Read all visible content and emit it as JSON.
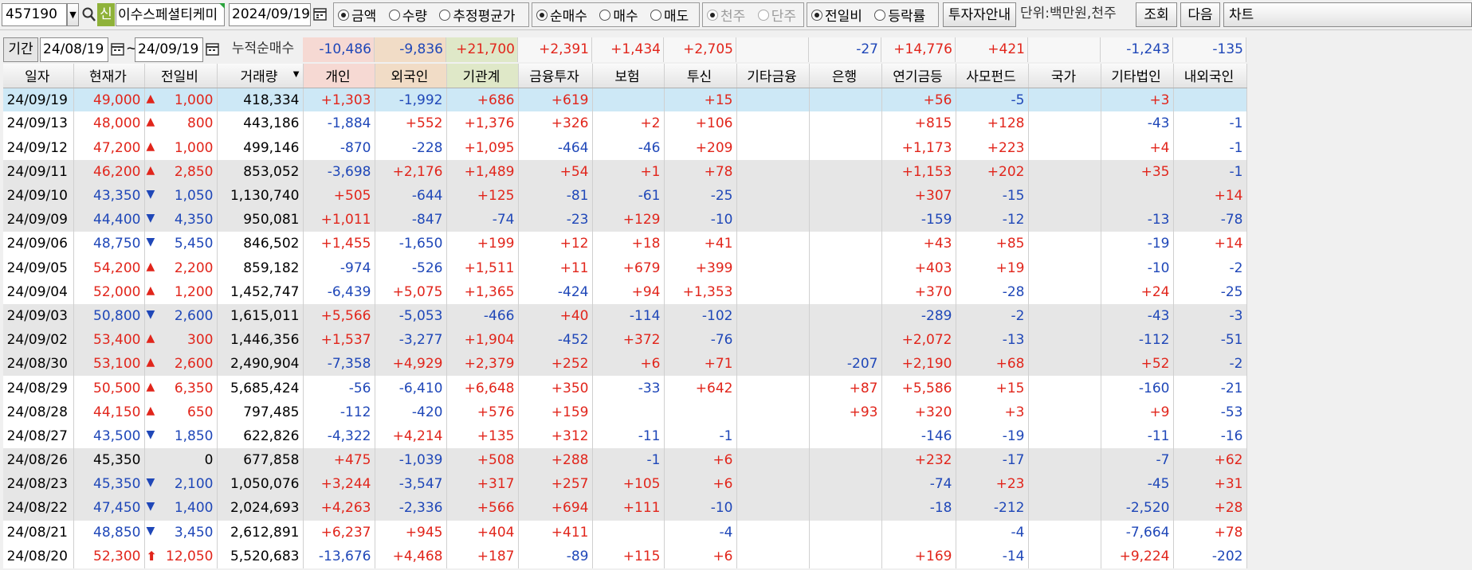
{
  "toolbar": {
    "code": "457190",
    "new_badge": "신",
    "stock_name": "이수스페셜티케미",
    "date": "2024/09/19",
    "value_radios": [
      {
        "label": "금액",
        "on": true
      },
      {
        "label": "수량",
        "on": false
      },
      {
        "label": "추정평균가",
        "on": false
      }
    ],
    "trade_radios": [
      {
        "label": "순매수",
        "on": true
      },
      {
        "label": "매수",
        "on": false
      },
      {
        "label": "매도",
        "on": false
      }
    ],
    "unit_radios": [
      {
        "label": "천주",
        "on": true
      },
      {
        "label": "단주",
        "on": false
      }
    ],
    "compare_radios": [
      {
        "label": "전일비",
        "on": true
      },
      {
        "label": "등락률",
        "on": false
      }
    ],
    "investor_guide_button": "투자자안내",
    "unit_label": "단위:백만원,천주",
    "query_button": "조회",
    "next_button": "다음",
    "chart_button": "차트"
  },
  "period": {
    "label": "기간",
    "from": "24/08/19",
    "tilde": "~",
    "to": "24/09/19",
    "cumulative_label": "누적순매수",
    "sums": [
      "-10,486",
      "-9,836",
      "+21,700",
      "+2,391",
      "+1,434",
      "+2,705",
      "",
      "-27",
      "+14,776",
      "+421",
      "",
      "-1,243",
      "-135"
    ]
  },
  "columns": [
    "일자",
    "현재가",
    "전일비",
    "거래량",
    "개인",
    "외국인",
    "기관계",
    "금융투자",
    "보험",
    "투신",
    "기타금융",
    "은행",
    "연기금등",
    "사모펀드",
    "국가",
    "기타법인",
    "내외국인"
  ],
  "rows": [
    {
      "d": "24/09/19",
      "p": "49,000",
      "a": "up",
      "c": "1,000",
      "v": "418,334",
      "n": [
        "+1,303",
        "-1,992",
        "+686",
        "+619",
        "",
        "+15",
        "",
        "",
        "+56",
        "-5",
        "",
        "+3",
        ""
      ]
    },
    {
      "d": "24/09/13",
      "p": "48,000",
      "a": "up",
      "c": "800",
      "v": "443,186",
      "n": [
        "-1,884",
        "+552",
        "+1,376",
        "+326",
        "+2",
        "+106",
        "",
        "",
        "+815",
        "+128",
        "",
        "-43",
        "-1"
      ]
    },
    {
      "d": "24/09/12",
      "p": "47,200",
      "a": "up",
      "c": "1,000",
      "v": "499,146",
      "n": [
        "-870",
        "-228",
        "+1,095",
        "-464",
        "-46",
        "+209",
        "",
        "",
        "+1,173",
        "+223",
        "",
        "+4",
        "-1"
      ]
    },
    {
      "d": "24/09/11",
      "p": "46,200",
      "a": "up",
      "c": "2,850",
      "v": "853,052",
      "n": [
        "-3,698",
        "+2,176",
        "+1,489",
        "+54",
        "+1",
        "+78",
        "",
        "",
        "+1,153",
        "+202",
        "",
        "+35",
        "-1"
      ]
    },
    {
      "d": "24/09/10",
      "p": "43,350",
      "a": "down",
      "c": "1,050",
      "v": "1,130,740",
      "n": [
        "+505",
        "-644",
        "+125",
        "-81",
        "-61",
        "-25",
        "",
        "",
        "+307",
        "-15",
        "",
        "",
        "+14"
      ]
    },
    {
      "d": "24/09/09",
      "p": "44,400",
      "a": "down",
      "c": "4,350",
      "v": "950,081",
      "n": [
        "+1,011",
        "-847",
        "-74",
        "-23",
        "+129",
        "-10",
        "",
        "",
        "-159",
        "-12",
        "",
        "-13",
        "-78"
      ]
    },
    {
      "d": "24/09/06",
      "p": "48,750",
      "a": "down",
      "c": "5,450",
      "v": "846,502",
      "n": [
        "+1,455",
        "-1,650",
        "+199",
        "+12",
        "+18",
        "+41",
        "",
        "",
        "+43",
        "+85",
        "",
        "-19",
        "+14"
      ]
    },
    {
      "d": "24/09/05",
      "p": "54,200",
      "a": "up",
      "c": "2,200",
      "v": "859,182",
      "n": [
        "-974",
        "-526",
        "+1,511",
        "+11",
        "+679",
        "+399",
        "",
        "",
        "+403",
        "+19",
        "",
        "-10",
        "-2"
      ]
    },
    {
      "d": "24/09/04",
      "p": "52,000",
      "a": "up",
      "c": "1,200",
      "v": "1,452,747",
      "n": [
        "-6,439",
        "+5,075",
        "+1,365",
        "-424",
        "+94",
        "+1,353",
        "",
        "",
        "+370",
        "-28",
        "",
        "+24",
        "-25"
      ]
    },
    {
      "d": "24/09/03",
      "p": "50,800",
      "a": "down",
      "c": "2,600",
      "v": "1,615,011",
      "n": [
        "+5,566",
        "-5,053",
        "-466",
        "+40",
        "-114",
        "-102",
        "",
        "",
        "-289",
        "-2",
        "",
        "-43",
        "-3"
      ]
    },
    {
      "d": "24/09/02",
      "p": "53,400",
      "a": "up",
      "c": "300",
      "v": "1,446,356",
      "n": [
        "+1,537",
        "-3,277",
        "+1,904",
        "-452",
        "+372",
        "-76",
        "",
        "",
        "+2,072",
        "-13",
        "",
        "-112",
        "-51"
      ]
    },
    {
      "d": "24/08/30",
      "p": "53,100",
      "a": "up",
      "c": "2,600",
      "v": "2,490,904",
      "n": [
        "-7,358",
        "+4,929",
        "+2,379",
        "+252",
        "+6",
        "+71",
        "",
        "-207",
        "+2,190",
        "+68",
        "",
        "+52",
        "-2"
      ]
    },
    {
      "d": "24/08/29",
      "p": "50,500",
      "a": "up",
      "c": "6,350",
      "v": "5,685,424",
      "n": [
        "-56",
        "-6,410",
        "+6,648",
        "+350",
        "-33",
        "+642",
        "",
        "+87",
        "+5,586",
        "+15",
        "",
        "-160",
        "-21"
      ]
    },
    {
      "d": "24/08/28",
      "p": "44,150",
      "a": "up",
      "c": "650",
      "v": "797,485",
      "n": [
        "-112",
        "-420",
        "+576",
        "+159",
        "",
        "",
        "",
        "+93",
        "+320",
        "+3",
        "",
        "+9",
        "-53"
      ]
    },
    {
      "d": "24/08/27",
      "p": "43,500",
      "a": "down",
      "c": "1,850",
      "v": "622,826",
      "n": [
        "-4,322",
        "+4,214",
        "+135",
        "+312",
        "-11",
        "-1",
        "",
        "",
        "-146",
        "-19",
        "",
        "-11",
        "-16"
      ]
    },
    {
      "d": "24/08/26",
      "p": "45,350",
      "a": "none",
      "c": "0",
      "v": "677,858",
      "n": [
        "+475",
        "-1,039",
        "+508",
        "+288",
        "-1",
        "+6",
        "",
        "",
        "+232",
        "-17",
        "",
        "-7",
        "+62"
      ]
    },
    {
      "d": "24/08/23",
      "p": "45,350",
      "a": "down",
      "c": "2,100",
      "v": "1,050,076",
      "n": [
        "+3,244",
        "-3,547",
        "+317",
        "+257",
        "+105",
        "+6",
        "",
        "",
        "-74",
        "+23",
        "",
        "-45",
        "+31"
      ]
    },
    {
      "d": "24/08/22",
      "p": "47,450",
      "a": "down",
      "c": "1,400",
      "v": "2,024,693",
      "n": [
        "+4,263",
        "-2,336",
        "+566",
        "+694",
        "+111",
        "-10",
        "",
        "",
        "-18",
        "-212",
        "",
        "-2,520",
        "+28"
      ]
    },
    {
      "d": "24/08/21",
      "p": "48,850",
      "a": "down",
      "c": "3,450",
      "v": "2,612,891",
      "n": [
        "+6,237",
        "+945",
        "+404",
        "+411",
        "",
        "-4",
        "",
        "",
        "",
        "-4",
        "",
        "-7,664",
        "+78"
      ]
    },
    {
      "d": "24/08/20",
      "p": "52,300",
      "a": "upper",
      "c": "12,050",
      "v": "5,520,683",
      "n": [
        "-13,676",
        "+4,468",
        "+187",
        "-89",
        "+115",
        "+6",
        "",
        "",
        "+169",
        "-14",
        "",
        "+9,224",
        "-202"
      ]
    }
  ],
  "colors": {
    "up": "#e1251b",
    "down": "#1f47b8",
    "selected_row": "#cde8f6",
    "shaded_row": "#e6e6e6"
  },
  "icons": {
    "search": "search-icon",
    "calendar": "calendar-icon",
    "dropdown": "chevron-down-icon",
    "sort": "sort-down-icon",
    "up": "triangle-up-icon",
    "down": "triangle-down-icon",
    "upper_limit": "arrow-up-icon"
  }
}
